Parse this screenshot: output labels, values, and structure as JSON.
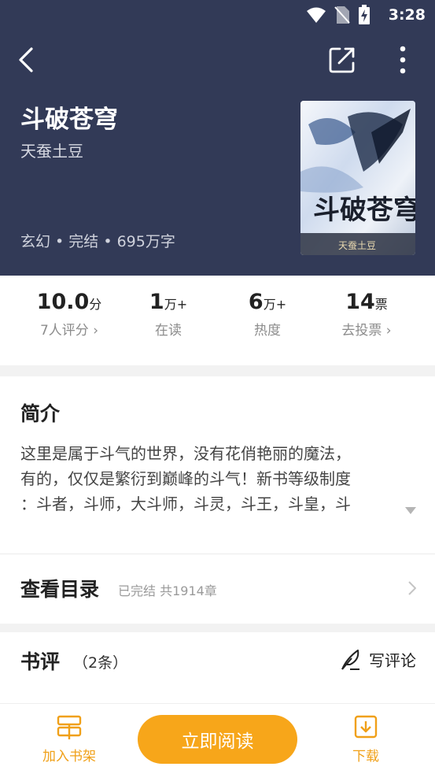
{
  "status_bar": {
    "time": "3:28"
  },
  "book": {
    "title": "斗破苍穹",
    "author": "天蚕土豆",
    "meta": "玄幻 • 完结 • 695万字",
    "cover_title": "斗破苍穹",
    "cover_author": "天蚕土豆"
  },
  "stats": [
    {
      "value": "10.0",
      "unit": "分",
      "label": "7人评分 ›"
    },
    {
      "value": "1",
      "unit": "万+",
      "label": "在读"
    },
    {
      "value": "6",
      "unit": "万+",
      "label": "热度"
    },
    {
      "value": "14",
      "unit": "票",
      "label": "去投票 ›"
    }
  ],
  "intro": {
    "title": "简介",
    "line1": "这里是属于斗气的世界，没有花俏艳丽的魔法，",
    "line2": "有的，仅仅是繁衍到巅峰的斗气！新书等级制度",
    "line3": "：斗者，斗师，大斗师，斗灵，斗王，斗皇，斗"
  },
  "toc": {
    "title": "查看目录",
    "status": "已完结 共1914章"
  },
  "reviews": {
    "title": "书评",
    "count": "（2条）",
    "write_label": "写评论"
  },
  "bottom_bar": {
    "shelf_label": "加入书架",
    "read_label": "立即阅读",
    "download_label": "下载"
  },
  "colors": {
    "header_bg": "#323a57",
    "accent": "#f7a61a"
  }
}
